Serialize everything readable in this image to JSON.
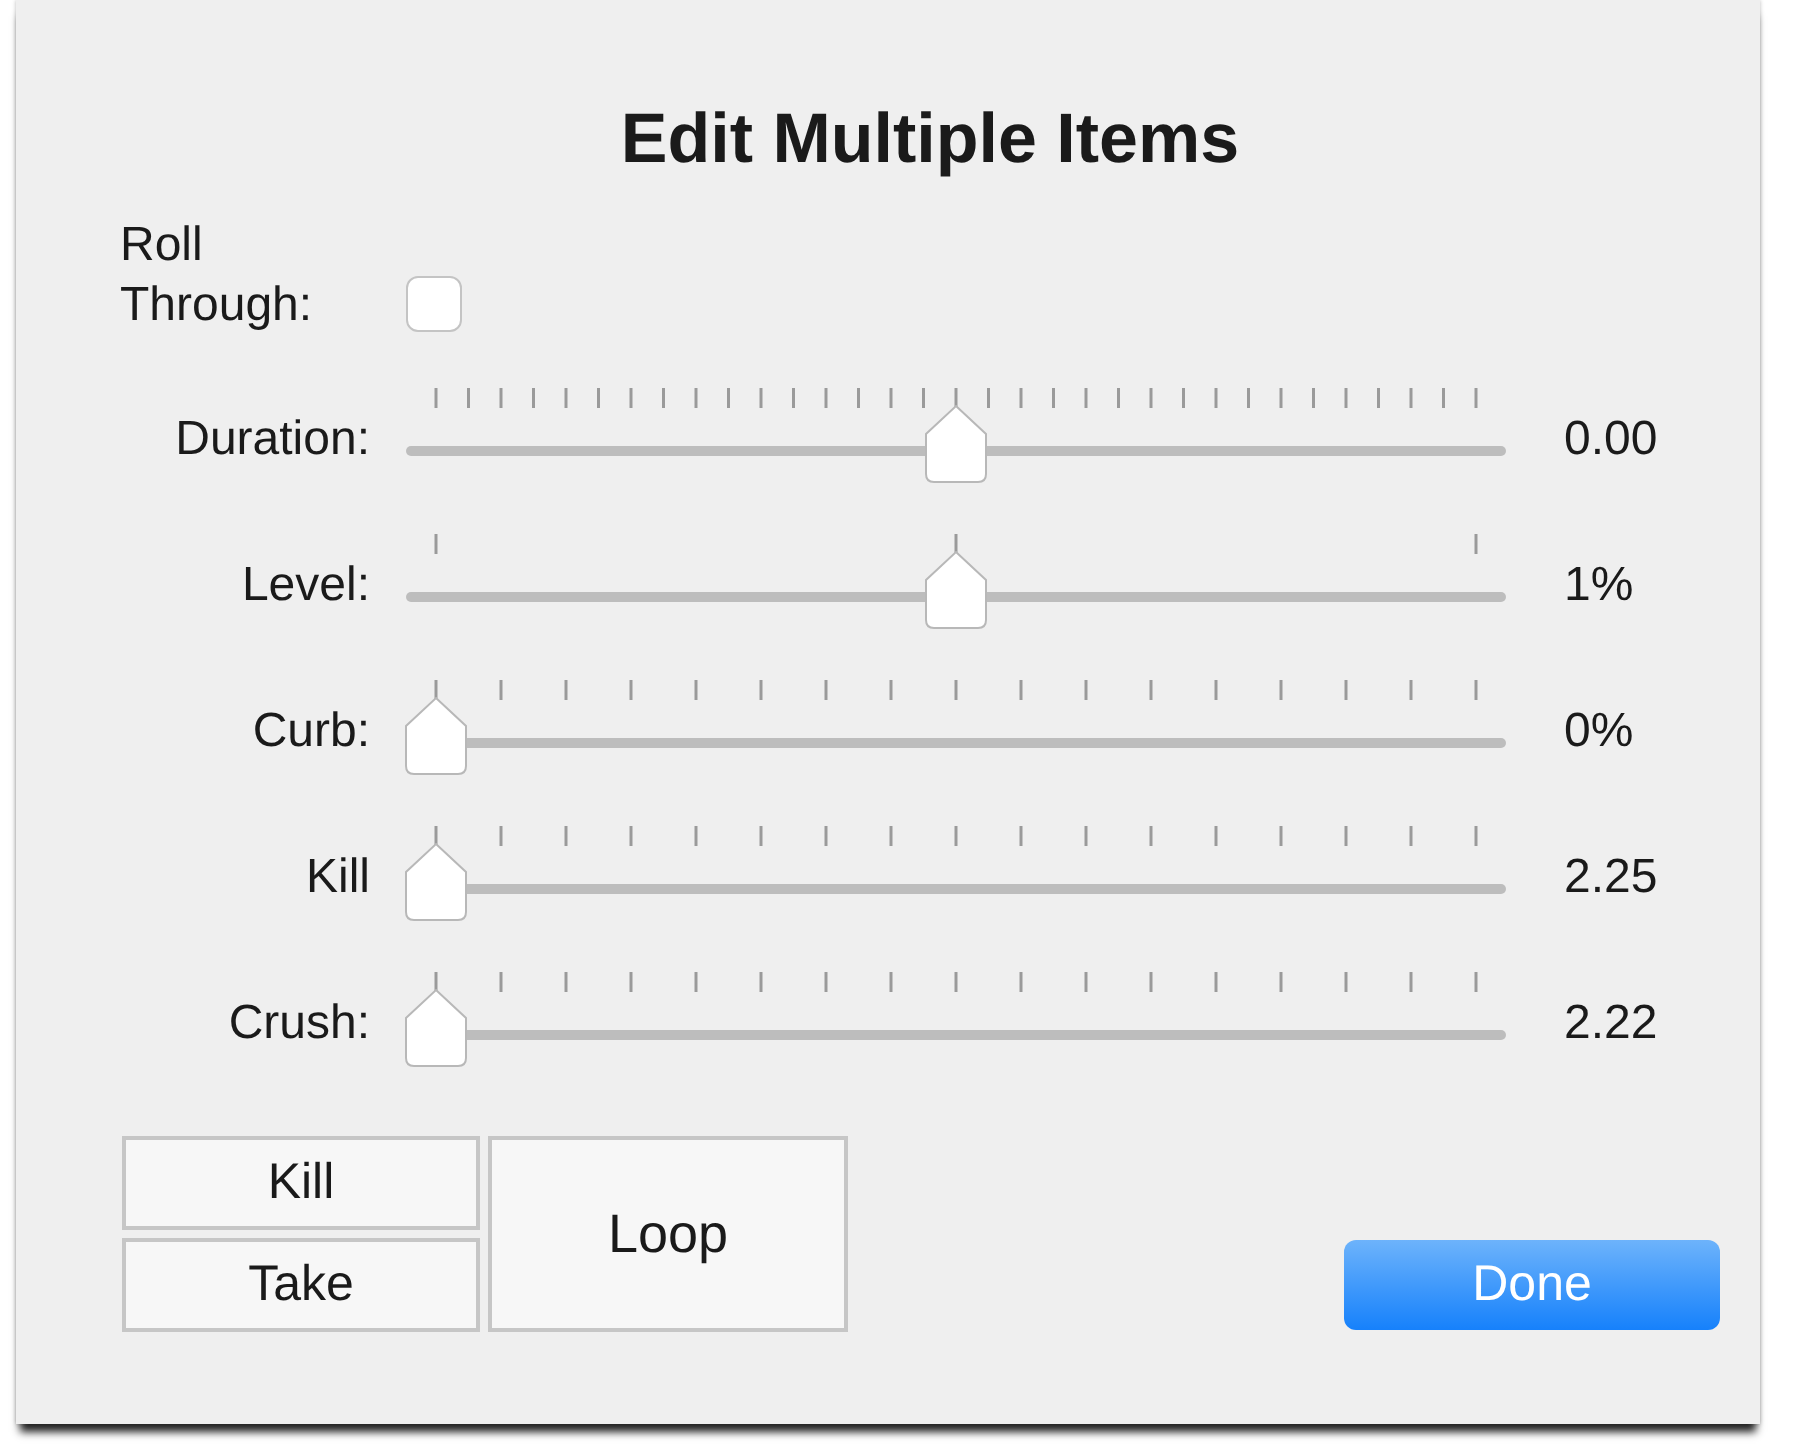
{
  "dialog": {
    "title": "Edit Multiple Items"
  },
  "roll_through": {
    "label": "Roll Through:",
    "checked": false
  },
  "sliders": [
    {
      "label": "Duration:",
      "level": 0.5,
      "reading": "0.00"
    },
    {
      "label": "Level:",
      "level": 0.5,
      "reading": "1%"
    },
    {
      "label": "Curb:",
      "level": 0,
      "reading": "0%"
    },
    {
      "label": "Kill",
      "level": 0,
      "reading": "2.25"
    },
    {
      "label": "Crush:",
      "level": 0,
      "reading": "2.22"
    }
  ],
  "buttons": [
    {
      "kind": "small",
      "label": "Kill"
    },
    {
      "kind": "small",
      "label": "Take"
    },
    {
      "kind": "large",
      "label": "Loop"
    },
    {
      "kind": "primary",
      "label": "Done"
    }
  ]
}
